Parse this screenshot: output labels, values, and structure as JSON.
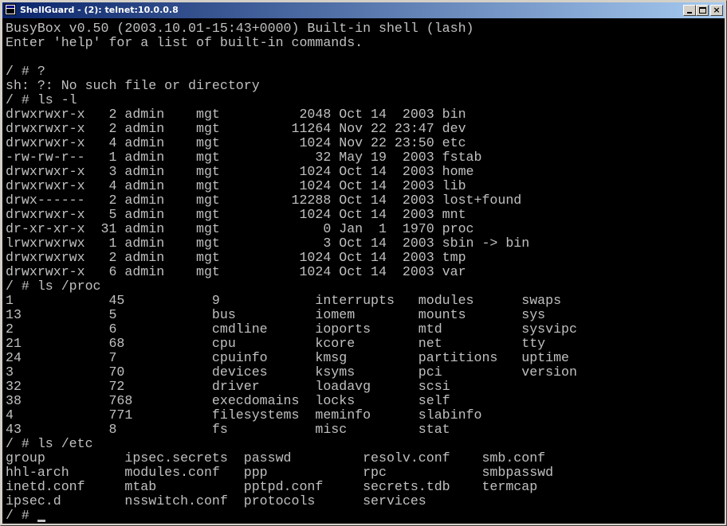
{
  "window": {
    "title": "ShellGuard - (2): telnet:10.0.0.8",
    "buttons": {
      "minimize": "minimize",
      "maximize": "maximize",
      "close": "×"
    }
  },
  "terminal": {
    "lines": [
      "BusyBox v0.50 (2003.10.01-15:43+0000) Built-in shell (lash)",
      "Enter 'help' for a list of built-in commands.",
      "",
      "/ # ?",
      "sh: ?: No such file or directory",
      "/ # ls -l",
      "drwxrwxr-x   2 admin    mgt          2048 Oct 14  2003 bin",
      "drwxrwxr-x   2 admin    mgt         11264 Nov 22 23:47 dev",
      "drwxrwxr-x   4 admin    mgt          1024 Nov 22 23:50 etc",
      "-rw-rw-r--   1 admin    mgt            32 May 19  2003 fstab",
      "drwxrwxr-x   3 admin    mgt          1024 Oct 14  2003 home",
      "drwxrwxr-x   4 admin    mgt          1024 Oct 14  2003 lib",
      "drwx------   2 admin    mgt         12288 Oct 14  2003 lost+found",
      "drwxrwxr-x   5 admin    mgt          1024 Oct 14  2003 mnt",
      "dr-xr-xr-x  31 admin    mgt             0 Jan  1  1970 proc",
      "lrwxrwxrwx   1 admin    mgt             3 Oct 14  2003 sbin -> bin",
      "drwxrwxrwx   2 admin    mgt          1024 Oct 14  2003 tmp",
      "drwxrwxr-x   6 admin    mgt          1024 Oct 14  2003 var",
      "/ # ls /proc",
      "1            45           9            interrupts   modules      swaps",
      "13           5            bus          iomem        mounts       sys",
      "2            6            cmdline      ioports      mtd          sysvipc",
      "21           68           cpu          kcore        net          tty",
      "24           7            cpuinfo      kmsg         partitions   uptime",
      "3            70           devices      ksyms        pci          version",
      "32           72           driver       loadavg      scsi",
      "38           768          execdomains  locks        self",
      "4            771          filesystems  meminfo      slabinfo",
      "43           8            fs           misc         stat",
      "/ # ls /etc",
      "group          ipsec.secrets  passwd         resolv.conf    smb.conf",
      "hhl-arch       modules.conf   ppp            rpc            smbpasswd",
      "inetd.conf     mtab           pptpd.conf     secrets.tdb    termcap",
      "ipsec.d        nsswitch.conf  protocols      services"
    ],
    "prompt": "/ # "
  }
}
